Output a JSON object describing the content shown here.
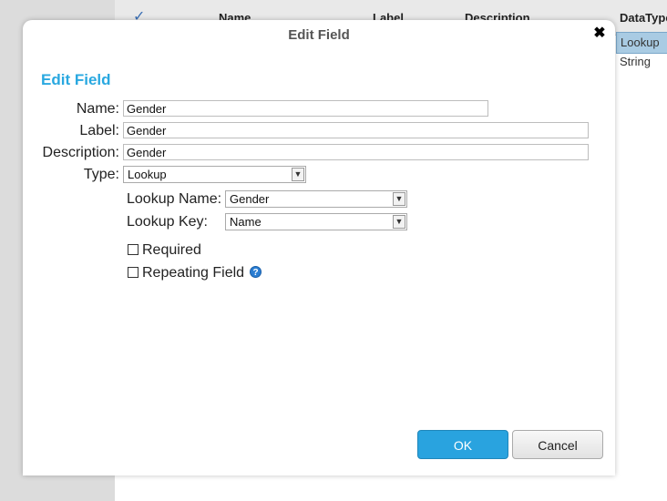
{
  "background": {
    "header": {
      "name": "Name",
      "label": "Label",
      "description": "Description",
      "datatype": "DataType"
    },
    "datatype_cells": [
      "Lookup",
      "String"
    ]
  },
  "dialog": {
    "title": "Edit Field",
    "heading": "Edit Field",
    "close_glyph": "✖",
    "fields": {
      "name": {
        "label": "Name:",
        "value": "Gender"
      },
      "label": {
        "label": "Label:",
        "value": "Gender"
      },
      "description": {
        "label": "Description:",
        "value": "Gender"
      },
      "type": {
        "label": "Type:",
        "value": "Lookup"
      }
    },
    "lookup": {
      "name": {
        "label": "Lookup Name:",
        "value": "Gender"
      },
      "key": {
        "label": "Lookup Key:",
        "value": "Name"
      }
    },
    "required_label": "Required",
    "repeating_label": "Repeating Field",
    "ok_label": "OK",
    "cancel_label": "Cancel"
  }
}
